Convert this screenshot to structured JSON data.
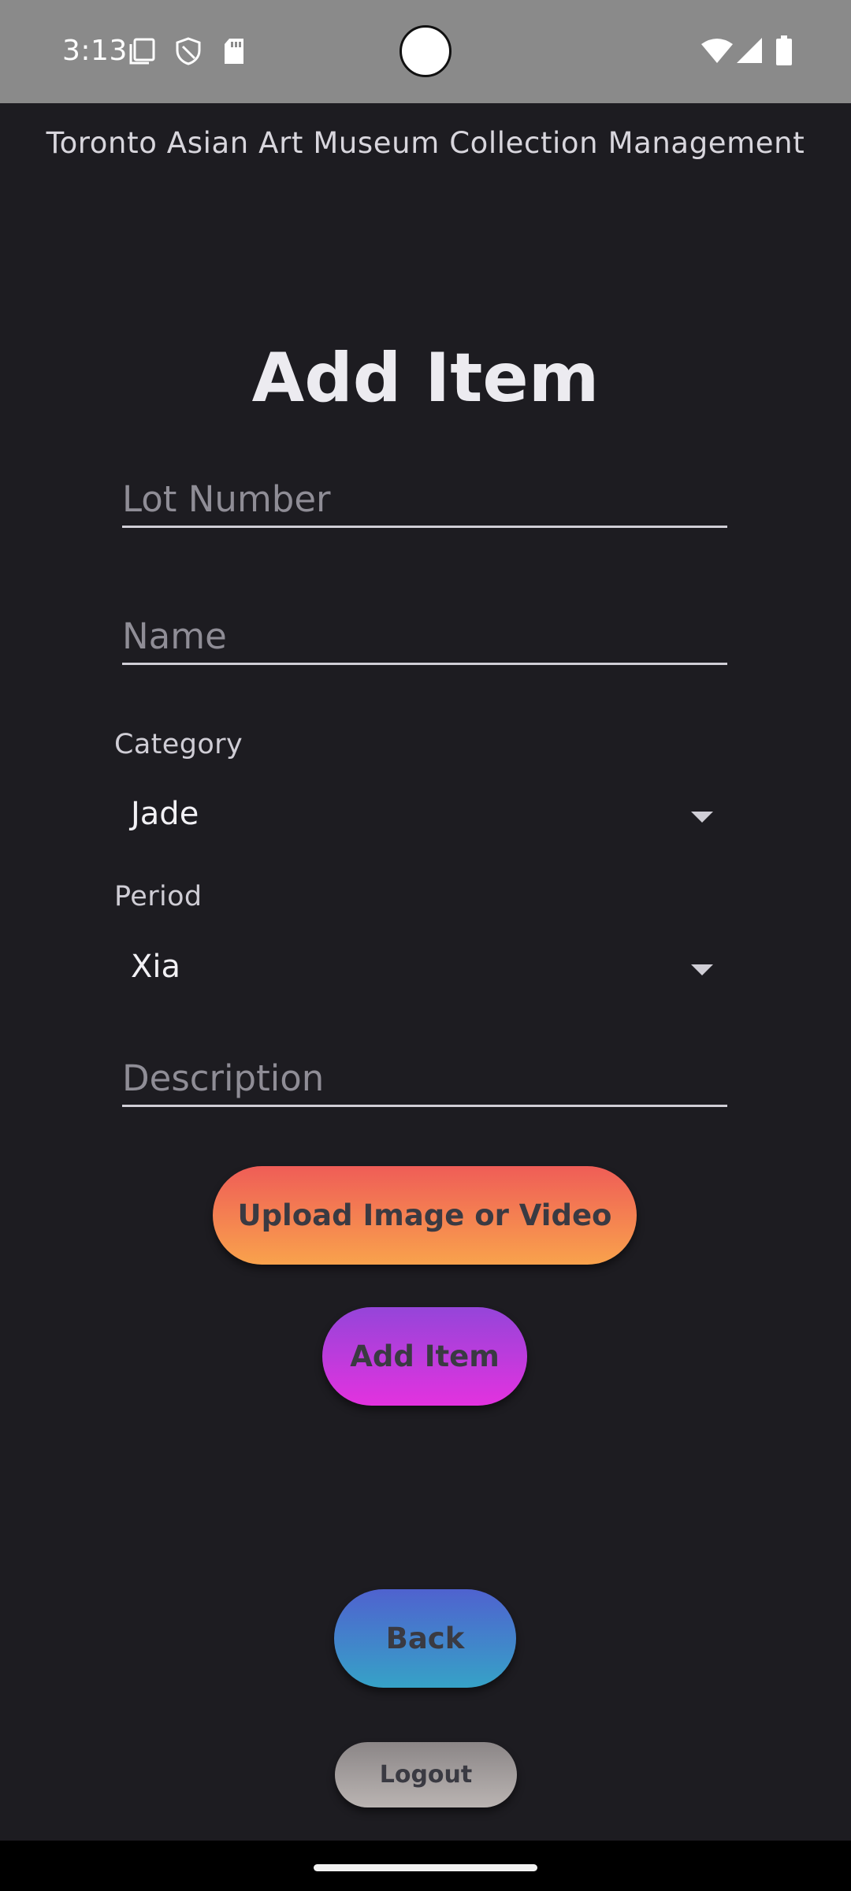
{
  "status_bar": {
    "time": "3:13",
    "icons": [
      "screenshot-icon",
      "shield-icon",
      "sd-card-icon",
      "wifi-icon",
      "signal-icon",
      "battery-icon"
    ]
  },
  "header": {
    "app_title": "Toronto Asian Art Museum Collection Management"
  },
  "form": {
    "title": "Add Item",
    "lot_number": {
      "value": "",
      "placeholder": "Lot Number"
    },
    "name": {
      "value": "",
      "placeholder": "Name"
    },
    "category": {
      "label": "Category",
      "selected": "Jade"
    },
    "period": {
      "label": "Period",
      "selected": "Xia"
    },
    "description": {
      "value": "",
      "placeholder": "Description"
    }
  },
  "buttons": {
    "upload": "Upload Image or Video",
    "add_item": "Add Item",
    "back": "Back",
    "logout": "Logout"
  },
  "colors": {
    "background": "#1d1c21",
    "status_bar": "#8a8a8a",
    "upload_gradient": [
      "#ef5d57",
      "#f9a24c"
    ],
    "add_gradient": [
      "#9545d9",
      "#e332df"
    ],
    "back_gradient": [
      "#4f62cf",
      "#36a2c7"
    ],
    "logout_gradient": [
      "#8b8687",
      "#bab4b2"
    ]
  }
}
